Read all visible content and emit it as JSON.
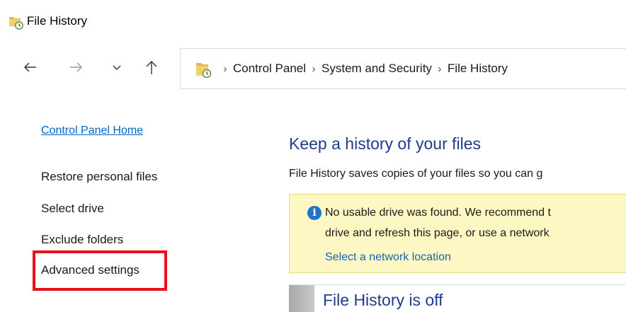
{
  "window": {
    "title": "File History",
    "icon": "file-history-icon"
  },
  "nav": {
    "back_icon": "arrow-left-icon",
    "forward_icon": "arrow-right-icon",
    "recent_icon": "chevron-down-icon",
    "up_icon": "arrow-up-icon"
  },
  "address_bar": {
    "icon": "file-history-icon",
    "crumbs": [
      "Control Panel",
      "System and Security",
      "File History"
    ],
    "separator": "›"
  },
  "left_pane": {
    "home_link": "Control Panel Home",
    "links": [
      "Restore personal files",
      "Select drive",
      "Exclude folders",
      "Advanced settings"
    ],
    "highlighted": "Advanced settings"
  },
  "main": {
    "title": "Keep a history of your files",
    "description": "File History saves copies of your files so you can g",
    "notice": {
      "line1": "No usable drive was found. We recommend t",
      "line2": "drive and refresh this page, or use a network",
      "link": "Select a network location",
      "icon": "info-icon"
    },
    "status": "File History is off"
  },
  "colors": {
    "link_blue": "#0066cc",
    "heading_blue": "#1e3c8c",
    "notice_bg": "#fdf7c3",
    "highlight_red": "#e8101c"
  }
}
